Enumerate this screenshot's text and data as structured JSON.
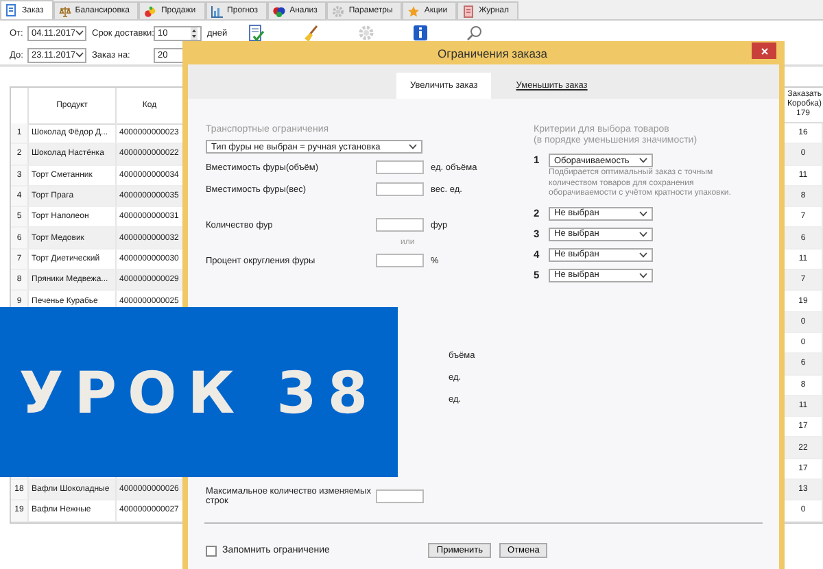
{
  "tabs": [
    {
      "label": "Заказ",
      "selected": true
    },
    {
      "label": "Балансировка",
      "selected": false
    },
    {
      "label": "Продажи",
      "selected": false
    },
    {
      "label": "Прогноз",
      "selected": false
    },
    {
      "label": "Анализ",
      "selected": false
    },
    {
      "label": "Параметры",
      "selected": false
    },
    {
      "label": "Акции",
      "selected": false
    },
    {
      "label": "Журнал",
      "selected": false
    }
  ],
  "toolbar": {
    "from": {
      "label": "От:",
      "value": "04.11.2017"
    },
    "delivery": {
      "label": "Срок доставки:",
      "value": "10",
      "unit": "дней"
    },
    "to": {
      "label": "До:",
      "value": "23.11.2017"
    },
    "order_for": {
      "label": "Заказ на:",
      "value": "20"
    }
  },
  "table": {
    "columns": [
      "Продукт",
      "Код"
    ],
    "order_column": [
      "Заказать",
      "Коробка)"
    ],
    "order_total": "179",
    "rows": [
      {
        "number": "1",
        "product": "Шоколад Фёдор Д...",
        "code": "4000000000023",
        "order": "16"
      },
      {
        "number": "2",
        "product": "Шоколад Настёнка",
        "code": "4000000000022",
        "order": "0"
      },
      {
        "number": "3",
        "product": "Торт Сметанник",
        "code": "4000000000034",
        "order": "11"
      },
      {
        "number": "4",
        "product": "Торт Прага",
        "code": "4000000000035",
        "order": "8"
      },
      {
        "number": "5",
        "product": "Торт Наполеон",
        "code": "4000000000031",
        "order": "7"
      },
      {
        "number": "6",
        "product": "Торт Медовик",
        "code": "4000000000032",
        "order": "6"
      },
      {
        "number": "7",
        "product": "Торт Диетический",
        "code": "4000000000030",
        "order": "11"
      },
      {
        "number": "8",
        "product": "Пряники Медвежа...",
        "code": "4000000000029",
        "order": "7"
      },
      {
        "number": "9",
        "product": "Печенье Курабье",
        "code": "4000000000025",
        "order": "19"
      },
      {
        "order": "0"
      },
      {
        "order": "0"
      },
      {
        "order": "6"
      },
      {
        "order": "8"
      },
      {
        "order": "11"
      },
      {
        "order": "17"
      },
      {
        "order": "22"
      },
      {
        "order": "17"
      },
      {
        "number": "18",
        "product": "Вафли Шоколадные",
        "code": "4000000000026",
        "order": "13"
      },
      {
        "number": "19",
        "product": "Вафли Нежные",
        "code": "4000000000027",
        "order": "0"
      }
    ]
  },
  "dialog": {
    "title": "Ограничения заказа",
    "tabs": [
      {
        "label": "Увеличить заказ",
        "selected": true
      },
      {
        "label": "Уменьшить заказ",
        "selected": false
      }
    ],
    "transport": {
      "heading": "Транспортные ограничения",
      "truck_type": "Тип фуры не выбран = ручная установка",
      "fields": [
        {
          "label": "Вместимость фуры(объём)",
          "unit": "ед. объёма"
        },
        {
          "label": "Вместимость фуры(вес)",
          "unit": "вес. ед."
        },
        {
          "label": "Количество фур",
          "unit": "фур"
        },
        {
          "label": "Процент округления фуры",
          "unit": "%"
        }
      ],
      "or": "или",
      "covered_units": [
        "бъёма",
        "ед.",
        "ед."
      ],
      "max_rows": "Максимальное количество изменяемых строк"
    },
    "criteria": {
      "heading": "Критерии для выбора товаров",
      "subheading": "(в порядке уменьшения значимости)",
      "items": [
        {
          "number": "1",
          "value": "Оборачиваемость",
          "description": "Подбирается оптимальный заказ с точным количеством товаров для сохранения оборачиваемости с учётом кратности упаковки."
        },
        {
          "number": "2",
          "value": "Не выбран"
        },
        {
          "number": "3",
          "value": "Не выбран"
        },
        {
          "number": "4",
          "value": "Не выбран"
        },
        {
          "number": "5",
          "value": "Не выбран"
        }
      ]
    },
    "remember": {
      "label": "Запомнить ограничение",
      "checked": false
    },
    "buttons": [
      "Применить",
      "Отмена"
    ]
  },
  "banner": {
    "text": "УРОК 38"
  }
}
